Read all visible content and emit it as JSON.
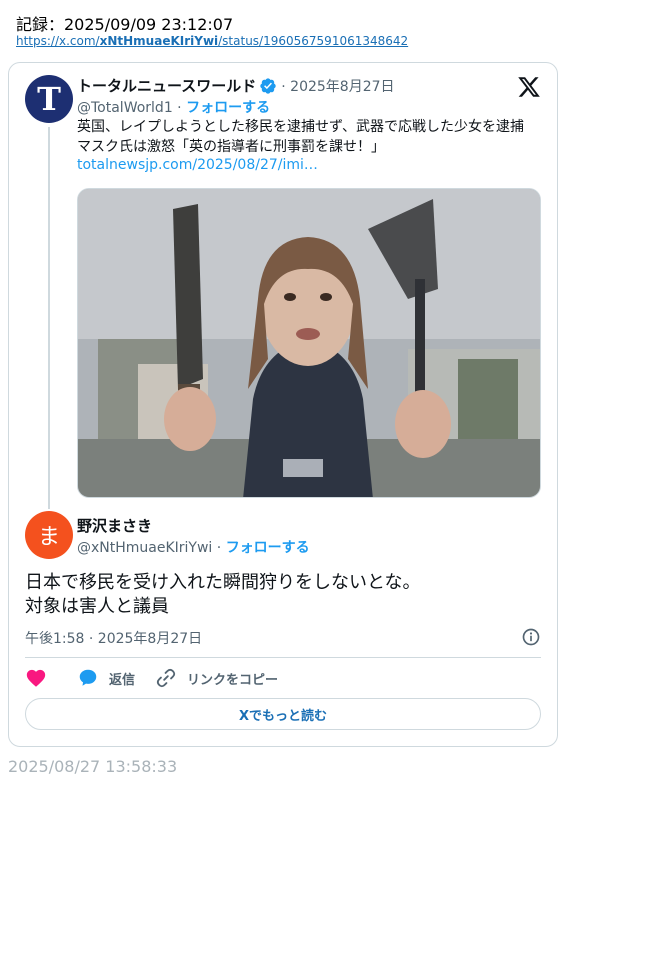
{
  "record": {
    "label": "記録：2025/09/09 23:12:07",
    "url_prefix": "https://x.com/",
    "url_user": "xNtHmuaeKIriYwi",
    "url_suffix": "/status/1960567591061348642"
  },
  "quoted_tweet": {
    "avatar_letter": "T",
    "display_name": "トータルニュースワールド",
    "date": "· 2025年8月27日",
    "handle": "@TotalWorld1 ·",
    "follow_label": "フォローする",
    "text": "英国、レイプしようとした移民を逮捕せず、武器で応戦した少女を逮捕　マスク氏は激怒「英の指導者に刑事罰を課せ！」",
    "link": "totalnewsjp.com/2025/08/27/imi…"
  },
  "main_tweet": {
    "avatar_letter": "ま",
    "display_name": "野沢まさき",
    "handle": "@xNtHmuaeKIriYwi ·",
    "follow_label": "フォローする",
    "text_line1": "日本で移民を受け入れた瞬間狩りをしないとな。",
    "text_line2": "対象は害人と議員",
    "time": "午後1:58 · 2025年8月27日"
  },
  "actions": {
    "reply_label": "返信",
    "copy_label": "リンクをコピー"
  },
  "read_more_label": "Xでもっと読む",
  "footer_timestamp": "2025/08/27 13:58:33",
  "colors": {
    "accent": "#1d9bf0",
    "heart": "#f91880",
    "text": "#0f1419",
    "muted": "#536471",
    "border": "#cfd9de",
    "quoted_avatar": "#1d2f72",
    "main_avatar": "#f4511e"
  },
  "icons": [
    "verified-badge-icon",
    "x-logo-icon",
    "info-icon",
    "heart-icon",
    "reply-bubble-icon",
    "link-icon"
  ]
}
